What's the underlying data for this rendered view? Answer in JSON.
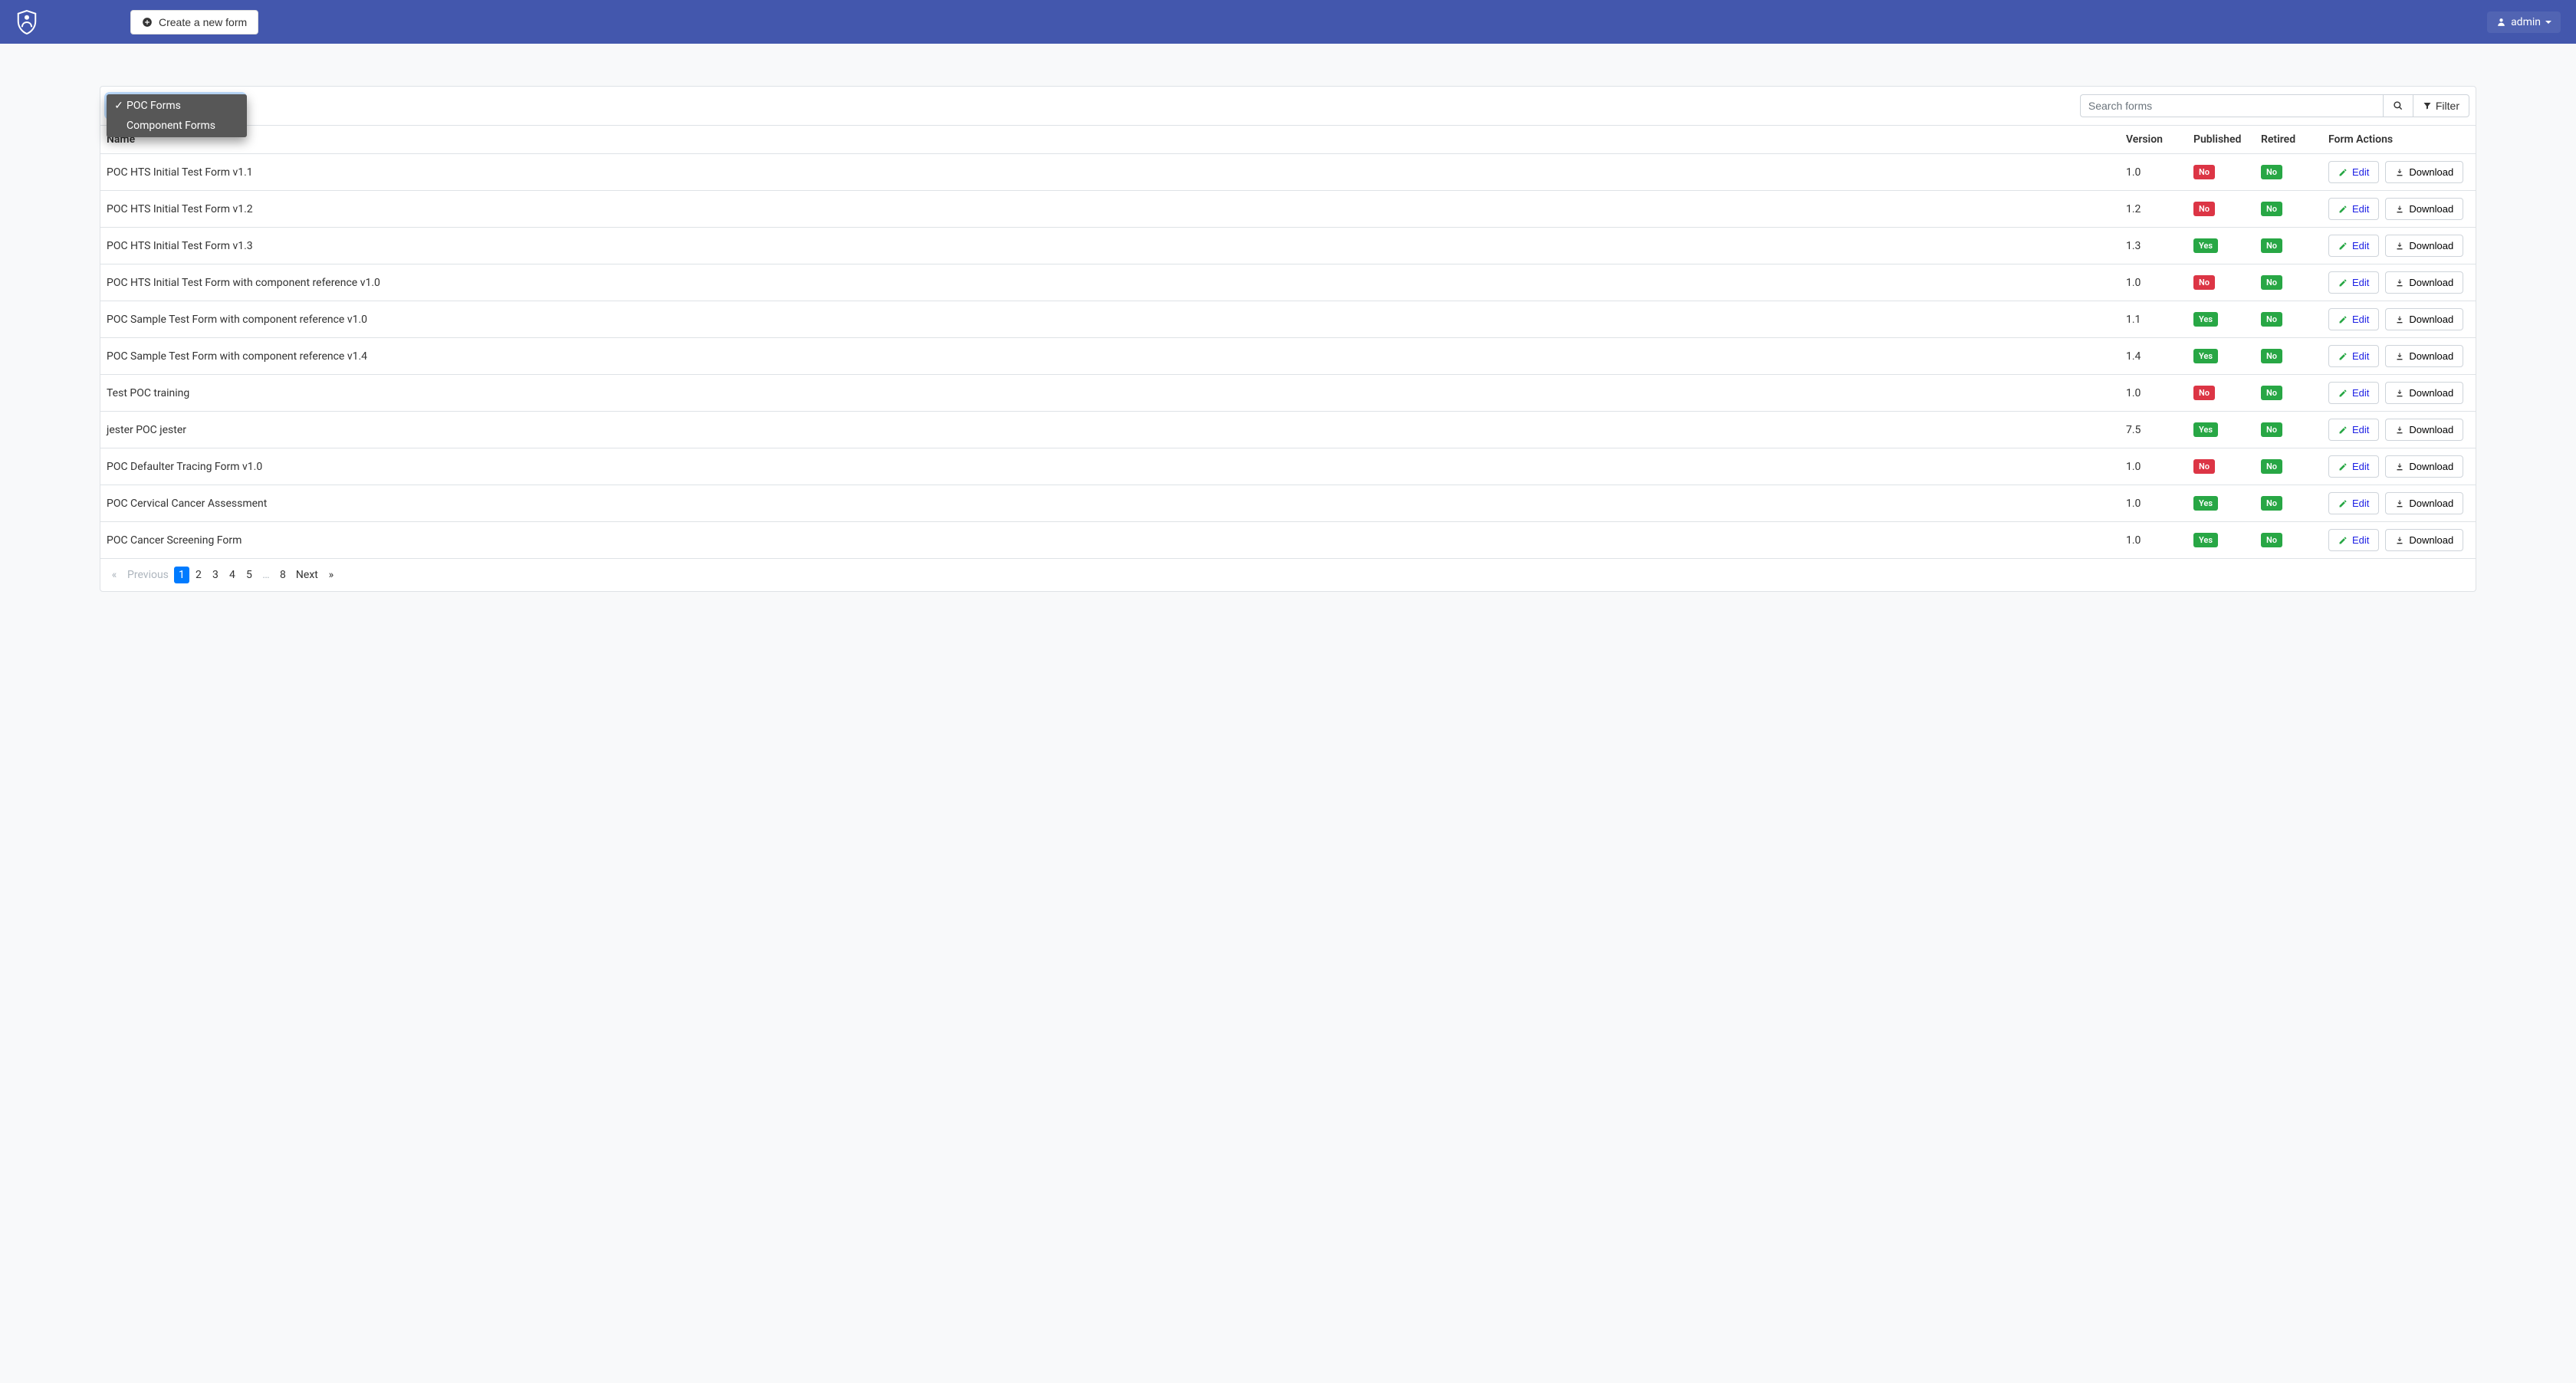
{
  "topbar": {
    "create_label": "Create a new form",
    "user_label": "admin"
  },
  "dropdown": {
    "selected": "POC Forms",
    "items": [
      {
        "label": "POC Forms",
        "checked": true
      },
      {
        "label": "Component Forms",
        "checked": false
      }
    ]
  },
  "search": {
    "placeholder": "Search forms",
    "filter_label": "Filter"
  },
  "columns": {
    "name": "Name",
    "version": "Version",
    "published": "Published",
    "retired": "Retired",
    "actions": "Form Actions"
  },
  "buttons": {
    "edit": "Edit",
    "download": "Download"
  },
  "badges": {
    "yes": "Yes",
    "no": "No"
  },
  "rows": [
    {
      "name": "POC HTS Initial Test Form v1.1",
      "version": "1.0",
      "published": "No",
      "retired": "No"
    },
    {
      "name": "POC HTS Initial Test Form v1.2",
      "version": "1.2",
      "published": "No",
      "retired": "No"
    },
    {
      "name": "POC HTS Initial Test Form v1.3",
      "version": "1.3",
      "published": "Yes",
      "retired": "No"
    },
    {
      "name": "POC HTS Initial Test Form with component reference v1.0",
      "version": "1.0",
      "published": "No",
      "retired": "No"
    },
    {
      "name": "POC Sample Test Form with component reference v1.0",
      "version": "1.1",
      "published": "Yes",
      "retired": "No"
    },
    {
      "name": "POC Sample Test Form with component reference v1.4",
      "version": "1.4",
      "published": "Yes",
      "retired": "No"
    },
    {
      "name": "Test POC training",
      "version": "1.0",
      "published": "No",
      "retired": "No"
    },
    {
      "name": "jester POC jester",
      "version": "7.5",
      "published": "Yes",
      "retired": "No"
    },
    {
      "name": "POC Defaulter Tracing Form v1.0",
      "version": "1.0",
      "published": "No",
      "retired": "No"
    },
    {
      "name": "POC Cervical Cancer Assessment",
      "version": "1.0",
      "published": "Yes",
      "retired": "No"
    },
    {
      "name": "POC Cancer Screening Form",
      "version": "1.0",
      "published": "Yes",
      "retired": "No"
    }
  ],
  "pagination": {
    "prev_sym": "«",
    "prev": "Previous",
    "pages": [
      "1",
      "2",
      "3",
      "4",
      "5",
      "…",
      "8"
    ],
    "active": "1",
    "next": "Next",
    "next_sym": "»"
  }
}
